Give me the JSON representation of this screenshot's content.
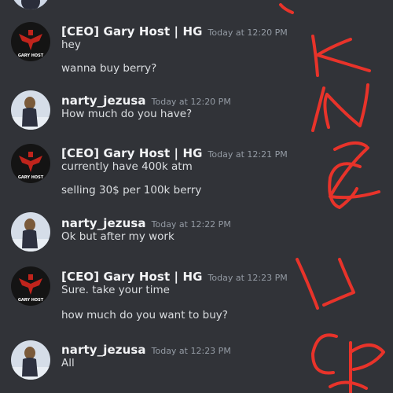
{
  "messages": [
    {
      "author": "[CEO]  Gary Host | HG",
      "time": "Today at 12:20 PM",
      "avatar": "gary-host-logo",
      "lines": [
        "hey",
        "wanna buy berry?"
      ]
    },
    {
      "author": "narty_jezusa",
      "time": "Today at 12:20 PM",
      "avatar": "narty-photo",
      "lines": [
        "How much do you have?"
      ]
    },
    {
      "author": "[CEO]  Gary Host | HG",
      "time": "Today at 12:21 PM",
      "avatar": "gary-host-logo",
      "lines": [
        "currently have 400k atm",
        "selling 30$ per 100k berry"
      ]
    },
    {
      "author": "narty_jezusa",
      "time": "Today at 12:22 PM",
      "avatar": "narty-photo",
      "lines": [
        "Ok but after my work"
      ]
    },
    {
      "author": "[CEO]  Gary Host | HG",
      "time": "Today at 12:23 PM",
      "avatar": "gary-host-logo",
      "lines": [
        "Sure. take your time",
        "how much do you want to buy?"
      ]
    },
    {
      "author": "narty_jezusa",
      "time": "Today at 12:23 PM",
      "avatar": "narty-photo",
      "lines": [
        "All"
      ]
    }
  ],
  "gary_logo_text": "GARY HOST",
  "colors": {
    "background": "#313338",
    "username": "#f2f3f5",
    "timestamp": "#949ba4",
    "message_text": "#dbdee1",
    "scribble": "#e8332a"
  }
}
